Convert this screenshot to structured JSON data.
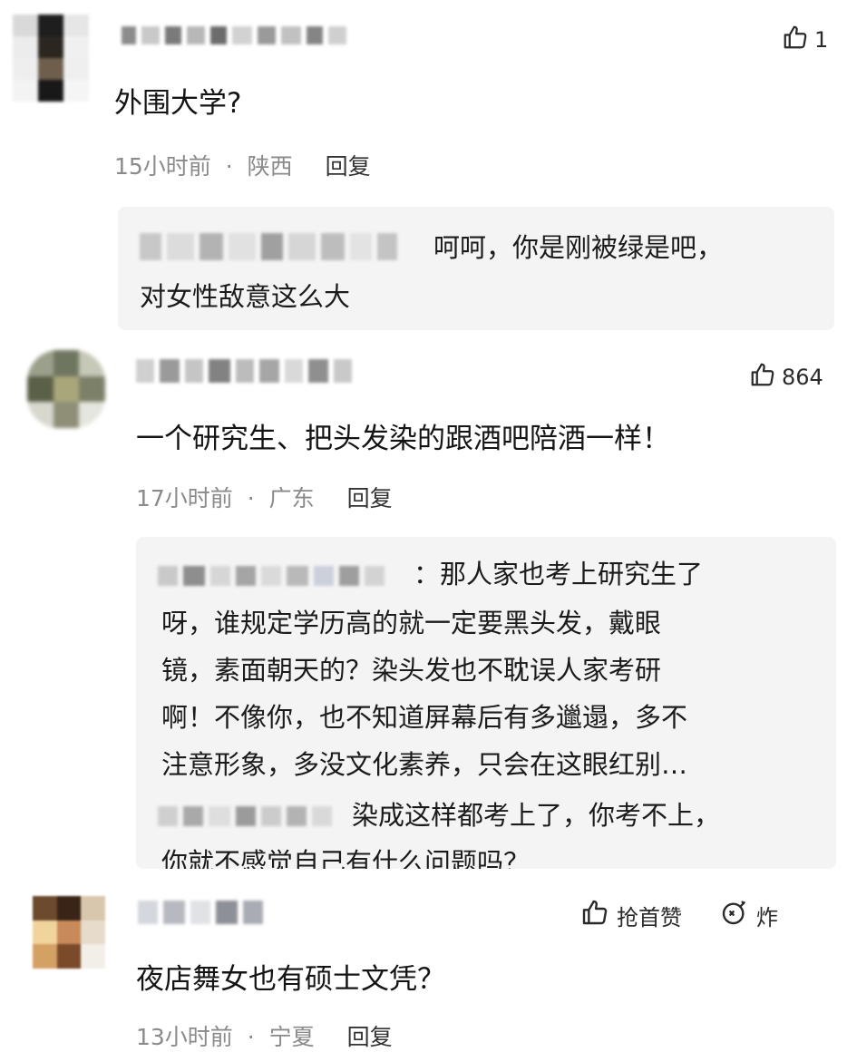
{
  "comments": [
    {
      "likes": "1",
      "text": "外围大学?",
      "time": "15小时前",
      "sep": "·",
      "location": "陕西",
      "reply_label": "回复",
      "replies": [
        {
          "lines": [
            "呵呵，你是刚被绿是吧，",
            "对女性敌意这么大"
          ]
        }
      ]
    },
    {
      "likes": "864",
      "text": "一个研究生、把头发染的跟酒吧陪酒一样！",
      "time": "17小时前",
      "sep": "·",
      "location": "广东",
      "reply_label": "回复",
      "replies": [
        {
          "lines": [
            "：那人家也考上研究生了",
            "呀，谁规定学历高的就一定要黑头发，戴眼",
            "镜，素面朝天的？染头发也不耽误人家考研",
            "啊！不像你，也不知道屏幕后有多邋遢，多不",
            "注意形象，多没文化素养，只会在这眼红别…"
          ]
        },
        {
          "lines": [
            "染成这样都考上了，你考不上，",
            "你就不感觉自己有什么问题吗？"
          ]
        }
      ]
    },
    {
      "first_like_label": "抢首赞",
      "boom_label": "炸",
      "text": "夜店舞女也有硕士文凭？",
      "time": "13小时前",
      "sep": "·",
      "location": "宁夏",
      "reply_label": "回复"
    }
  ],
  "icons": {
    "like": "thumbs-up-icon",
    "boom": "bomb-icon"
  },
  "colors": {
    "text": "#141414",
    "meta": "#8a8a8a",
    "reply_bg": "#f4f4f5"
  }
}
